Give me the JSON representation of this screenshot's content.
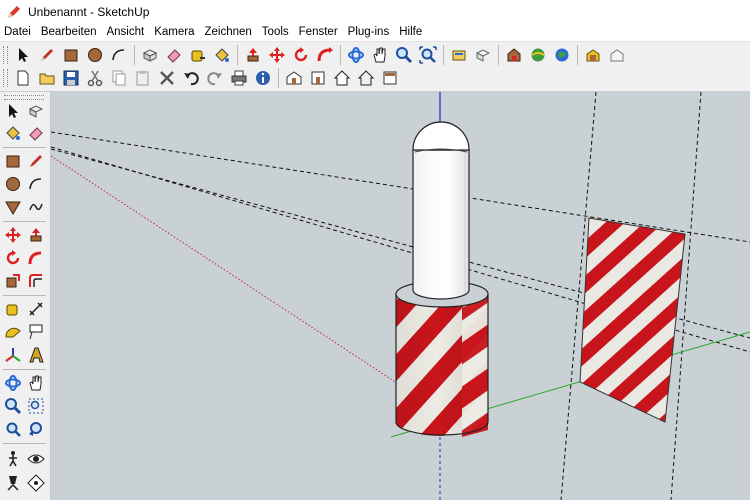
{
  "window": {
    "title": "Unbenannt - SketchUp",
    "app_icon": "sketchup-pencil-icon"
  },
  "menu": [
    {
      "label": "Datei"
    },
    {
      "label": "Bearbeiten"
    },
    {
      "label": "Ansicht"
    },
    {
      "label": "Kamera"
    },
    {
      "label": "Zeichnen"
    },
    {
      "label": "Tools"
    },
    {
      "label": "Fenster"
    },
    {
      "label": "Plug-ins"
    },
    {
      "label": "Hilfe"
    }
  ],
  "toolbar_top": [
    "select-arrow-icon",
    "pencil-line-icon",
    "rectangle-icon",
    "circle-icon",
    "arc-icon",
    "make-component-icon",
    "eraser-icon",
    "tape-measure-icon",
    "paint-bucket-icon",
    "push-pull-icon",
    "move-icon",
    "rotate-icon",
    "follow-me-icon",
    "orbit-icon",
    "pan-hand-icon",
    "zoom-icon",
    "zoom-extents-icon",
    "get-models-icon",
    "share-model-icon",
    "component-store-icon",
    "geo-location-icon",
    "photo-textures-icon",
    "extension-warehouse-icon",
    "share-component-icon"
  ],
  "toolbar_bottom": [
    "new-file-icon",
    "open-file-icon",
    "save-file-icon",
    "cut-icon",
    "copy-icon",
    "paste-icon",
    "delete-icon",
    "undo-icon",
    "redo-icon",
    "print-icon",
    "model-info-icon",
    "iso-view-icon",
    "front-view-icon",
    "home-view-icon",
    "outline-house-icon",
    "top-view-icon"
  ],
  "sidebar_tools": [
    "select-arrow-icon",
    "make-component-icon",
    "paint-bucket-icon",
    "eraser-icon",
    "rectangle-icon",
    "pencil-line-icon",
    "circle-icon",
    "arc-icon",
    "polygon-icon",
    "freehand-icon",
    "move-icon",
    "push-pull-icon",
    "rotate-icon",
    "follow-me-icon",
    "scale-icon",
    "offset-icon",
    "tape-measure-icon",
    "dimension-icon",
    "protractor-icon",
    "text-label-icon",
    "axes-icon",
    "3d-text-icon",
    "orbit-icon",
    "pan-hand-icon",
    "zoom-icon",
    "zoom-window-icon",
    "zoom-extents-icon",
    "previous-view-icon",
    "walk-icon",
    "look-around-icon",
    "position-camera-icon",
    "section-plane-icon"
  ],
  "colors": {
    "viewport_bg": "#c9d1d4",
    "stripe_red": "#c8151b",
    "stripe_white": "#ecebe4",
    "axis_blue": "#2a36c8",
    "axis_green": "#2aa82a",
    "axis_red": "#c23030"
  }
}
